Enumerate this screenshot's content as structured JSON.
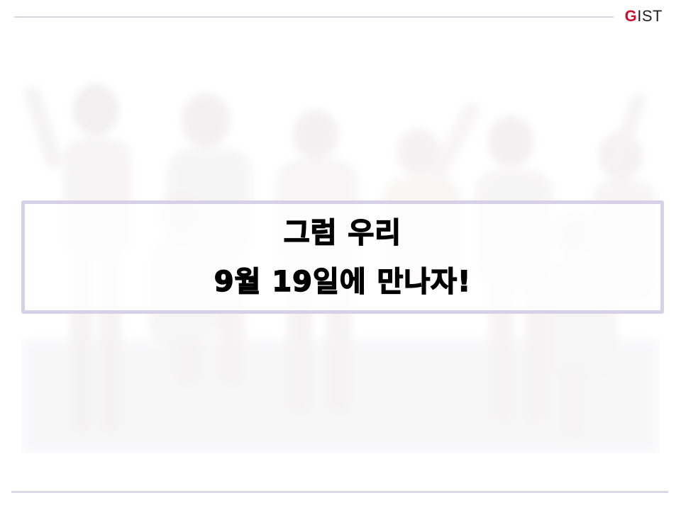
{
  "header": {
    "logo": {
      "first_letter": "G",
      "rest": "IST"
    }
  },
  "main": {
    "message": {
      "line1": "그럼 우리",
      "line2": "9월 19일에 만나자!"
    }
  },
  "colors": {
    "accent": "#c8102e",
    "frame": "#d7d1e8",
    "rule": "#d9d6e6"
  }
}
